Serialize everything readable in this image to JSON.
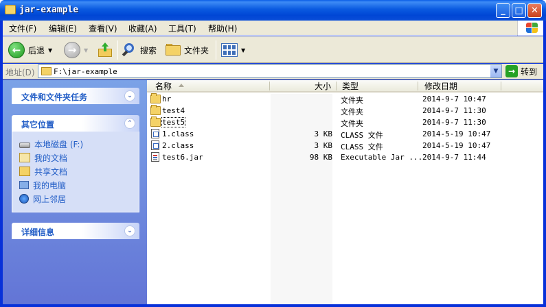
{
  "window": {
    "title": "jar-example"
  },
  "menu": [
    "文件(F)",
    "编辑(E)",
    "查看(V)",
    "收藏(A)",
    "工具(T)",
    "帮助(H)"
  ],
  "toolbar": {
    "back": "后退",
    "search": "搜索",
    "folders": "文件夹"
  },
  "address": {
    "label": "地址(D)",
    "value": "F:\\jar-example",
    "go": "转到"
  },
  "taskpane": {
    "panels": [
      {
        "title": "文件和文件夹任务"
      },
      {
        "title": "其它位置",
        "links": [
          "本地磁盘 (F:)",
          "我的文档",
          "共享文档",
          "我的电脑",
          "网上邻居"
        ]
      },
      {
        "title": "详细信息"
      }
    ]
  },
  "columns": [
    "名称",
    "大小",
    "类型",
    "修改日期"
  ],
  "files": [
    {
      "name": "hr",
      "size": "",
      "type": "文件夹",
      "date": "2014-9-7 10:47",
      "icon": "folder-icon"
    },
    {
      "name": "test4",
      "size": "",
      "type": "文件夹",
      "date": "2014-9-7 11:30",
      "icon": "folder-icon"
    },
    {
      "name": "test5",
      "size": "",
      "type": "文件夹",
      "date": "2014-9-7 11:30",
      "icon": "folder-icon"
    },
    {
      "name": "1.class",
      "size": "3 KB",
      "type": "CLASS 文件",
      "date": "2014-5-19 10:47",
      "icon": "class-file-icon"
    },
    {
      "name": "2.class",
      "size": "3 KB",
      "type": "CLASS 文件",
      "date": "2014-5-19 10:47",
      "icon": "class-file-icon"
    },
    {
      "name": "test6.jar",
      "size": "98 KB",
      "type": "Executable Jar ...",
      "date": "2014-9-7 11:44",
      "icon": "jar-file-icon"
    }
  ]
}
